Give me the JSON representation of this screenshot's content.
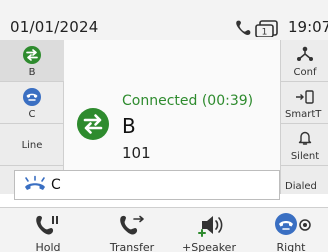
{
  "status_bar": {
    "date": "01/01/2024",
    "time": "19:07",
    "badge": "1",
    "icons": [
      "phone-icon",
      "message-window-icon"
    ]
  },
  "left_lines": [
    {
      "label": "B",
      "icon": "call-connected-icon",
      "color": "#2e8b2e"
    },
    {
      "label": "C",
      "icon": "call-incoming-icon",
      "color": "#3a6fc2"
    },
    {
      "label": "Line",
      "icon": ""
    }
  ],
  "call": {
    "status": "Connected (00:39)",
    "name": "B",
    "number": "101",
    "icon": "call-connected-icon",
    "color": "#2e8b2e"
  },
  "right_actions": [
    {
      "label": "Conf",
      "icon": "conference-icon"
    },
    {
      "label": "SmartT",
      "icon": "smart-transfer-icon"
    },
    {
      "label": "Silent",
      "icon": "bell-icon"
    },
    {
      "label": "Dialed",
      "icon": ""
    }
  ],
  "bottom_call": {
    "label": "C",
    "icon": "ringing-phone-icon",
    "color": "#3a6fc2"
  },
  "softkeys": [
    {
      "label": "Hold",
      "icon": "hold-icon"
    },
    {
      "label": "Transfer",
      "icon": "transfer-icon"
    },
    {
      "label": "+Speaker",
      "icon": "speaker-icon"
    },
    {
      "label": "Right",
      "icon": "answer-call-icon"
    }
  ],
  "colors": {
    "accent_green": "#2e8b2e",
    "accent_blue": "#3a6fc2",
    "icon_dark": "#333333"
  }
}
